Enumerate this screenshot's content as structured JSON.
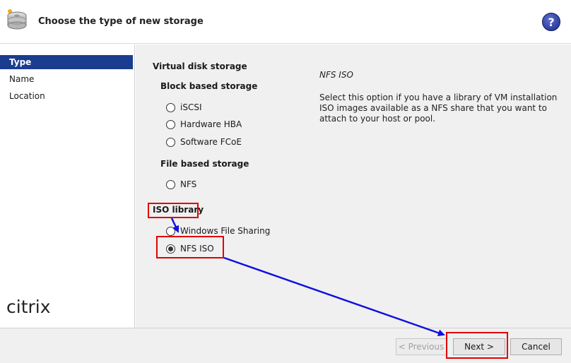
{
  "header": {
    "title": "Choose the type of new storage",
    "help_label": "?"
  },
  "sidebar": {
    "items": [
      {
        "label": "Type",
        "active": true
      },
      {
        "label": "Name",
        "active": false
      },
      {
        "label": "Location",
        "active": false
      }
    ],
    "logo_text": "citrix"
  },
  "main": {
    "virtual_disk_label": "Virtual disk storage",
    "block_based_label": "Block based storage",
    "file_based_label": "File based storage",
    "iso_library_label": "ISO library",
    "options": {
      "iscsi": "iSCSI",
      "hardware_hba": "Hardware HBA",
      "software_fcoe": "Software FCoE",
      "nfs": "NFS",
      "windows_file_sharing": "Windows File Sharing",
      "nfs_iso": "NFS ISO"
    },
    "selected_option": "NFS ISO"
  },
  "description": {
    "title": "NFS ISO",
    "text": "Select this option if you have a library of VM installation ISO images available as a NFS share that you want to attach to your host or pool."
  },
  "footer": {
    "previous_label": "< Previous",
    "next_label": "Next >",
    "cancel_label": "Cancel"
  },
  "annotation_colors": {
    "highlight": "#e00000",
    "arrow": "#1010e0",
    "selection": "#1a3d8f"
  }
}
